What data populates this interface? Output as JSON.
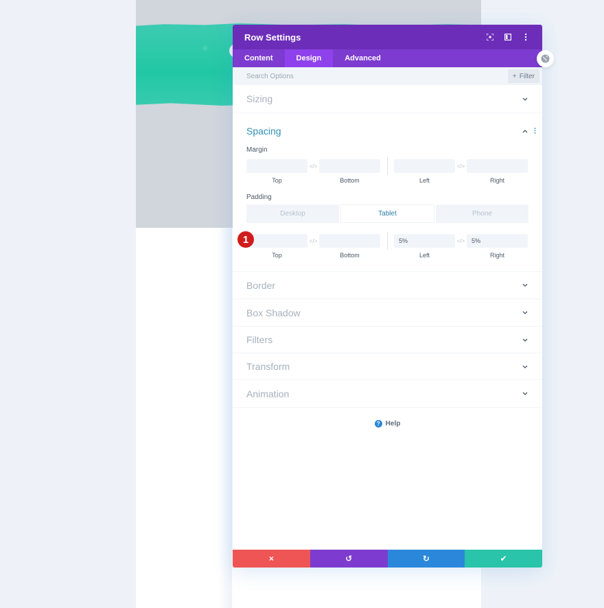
{
  "modal": {
    "title": "Row Settings",
    "header_icons": [
      "focus-icon",
      "split-view-icon",
      "more-vertical-icon"
    ],
    "tabs": [
      {
        "label": "Content",
        "active": false
      },
      {
        "label": "Design",
        "active": true
      },
      {
        "label": "Advanced",
        "active": false
      }
    ],
    "search": {
      "placeholder": "Search Options",
      "value": ""
    },
    "filter_label": "Filter",
    "sections": {
      "sizing": "Sizing",
      "spacing": "Spacing",
      "border": "Border",
      "box_shadow": "Box Shadow",
      "filters": "Filters",
      "transform": "Transform",
      "animation": "Animation"
    },
    "spacing": {
      "margin": {
        "label": "Margin",
        "top": "",
        "bottom": "",
        "left": "",
        "right": "",
        "labels": {
          "top": "Top",
          "bottom": "Bottom",
          "left": "Left",
          "right": "Right"
        }
      },
      "padding": {
        "label": "Padding",
        "device_tabs": [
          {
            "label": "Desktop",
            "active": false
          },
          {
            "label": "Tablet",
            "active": true
          },
          {
            "label": "Phone",
            "active": false
          }
        ],
        "top": "",
        "bottom": "",
        "left": "5%",
        "right": "5%",
        "labels": {
          "top": "Top",
          "bottom": "Bottom",
          "left": "Left",
          "right": "Right"
        }
      },
      "step_badge": "1"
    },
    "help_label": "Help",
    "footer": {
      "cancel_icon": "×",
      "undo_icon": "↺",
      "redo_icon": "↻",
      "save_icon": "✔"
    }
  },
  "colors": {
    "header": "#6c2eb9",
    "tabs": "#7d3bcf",
    "tab_active": "#8f42ec",
    "cancel": "#ef5555",
    "undo": "#7e3bd0",
    "redo": "#2b87da",
    "save": "#29c4a9",
    "badge": "#d01c1c",
    "spacing_title": "#2e8fb5"
  }
}
